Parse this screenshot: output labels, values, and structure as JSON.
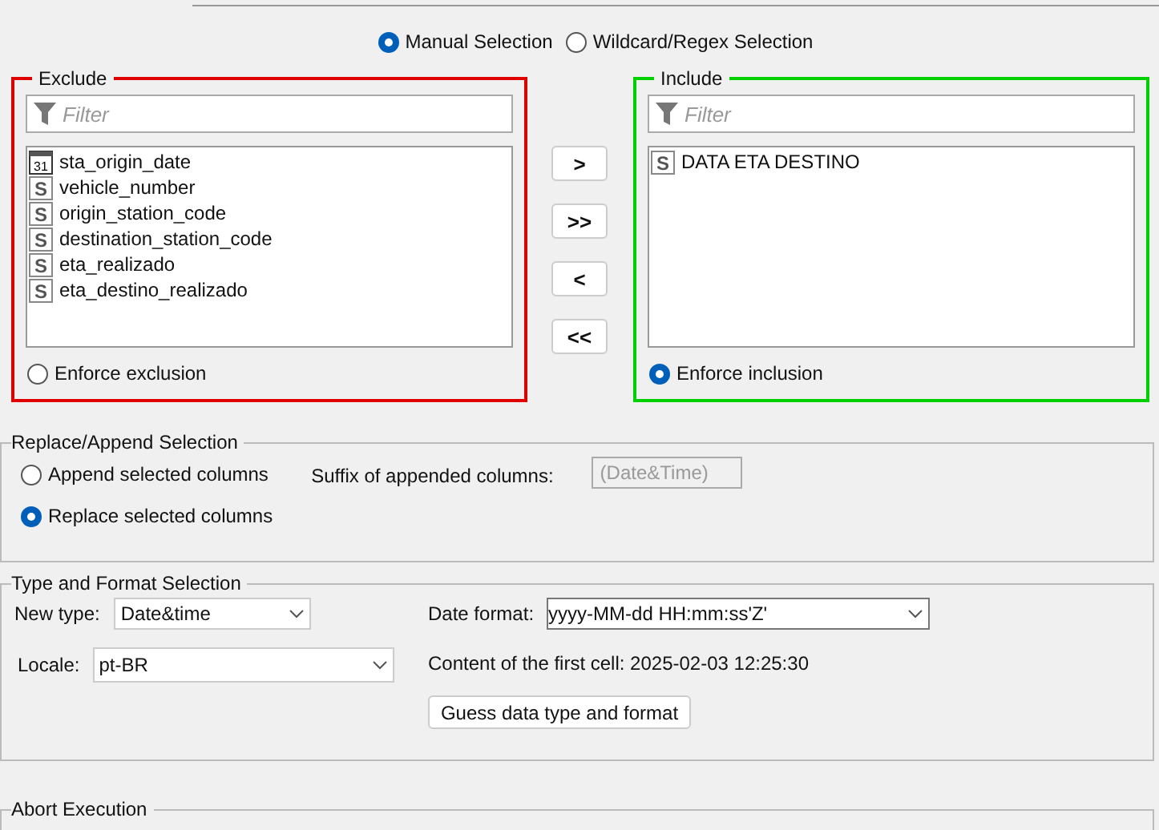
{
  "mode_options": [
    {
      "label": "Manual Selection",
      "selected": true
    },
    {
      "label": "Wildcard/Regex Selection",
      "selected": false
    }
  ],
  "panels": [
    {
      "kind": "exclude",
      "title": "Exclude",
      "filter_placeholder": "Filter",
      "columns": [
        {
          "kind": "date",
          "icon_text": "31",
          "name": "sta_origin_date"
        },
        {
          "kind": "string",
          "icon_text": "S",
          "name": "vehicle_number"
        },
        {
          "kind": "string",
          "icon_text": "S",
          "name": "origin_station_code"
        },
        {
          "kind": "string",
          "icon_text": "S",
          "name": "destination_station_code"
        },
        {
          "kind": "string",
          "icon_text": "S",
          "name": "eta_realizado"
        },
        {
          "kind": "string",
          "icon_text": "S",
          "name": "eta_destino_realizado"
        }
      ],
      "enforce": {
        "label": "Enforce exclusion",
        "selected": false
      }
    },
    {
      "kind": "include",
      "title": "Include",
      "filter_placeholder": "Filter",
      "columns": [
        {
          "kind": "string",
          "icon_text": "S",
          "name": "DATA ETA DESTINO"
        }
      ],
      "enforce": {
        "label": "Enforce inclusion",
        "selected": true
      }
    }
  ],
  "move_buttons": [
    ">",
    ">>",
    "<",
    "<<"
  ],
  "replace_append": {
    "title": "Replace/Append Selection",
    "options": [
      {
        "label": "Append selected columns",
        "selected": false
      },
      {
        "label": "Replace selected columns",
        "selected": true
      }
    ],
    "suffix_label": "Suffix of appended columns:",
    "suffix_placeholder": "(Date&Time)"
  },
  "type_format": {
    "title": "Type and Format Selection",
    "new_type_label": "New type:",
    "new_type": "Date&time",
    "locale_label": "Locale:",
    "locale": "pt-BR",
    "date_format_label": "Date format:",
    "date_format": "yyyy-MM-dd HH:mm:ss'Z'",
    "first_cell": "Content of the first cell: 2025-02-03 12:25:30",
    "guess_button": "Guess data type and format"
  },
  "abort": {
    "title": "Abort Execution"
  }
}
